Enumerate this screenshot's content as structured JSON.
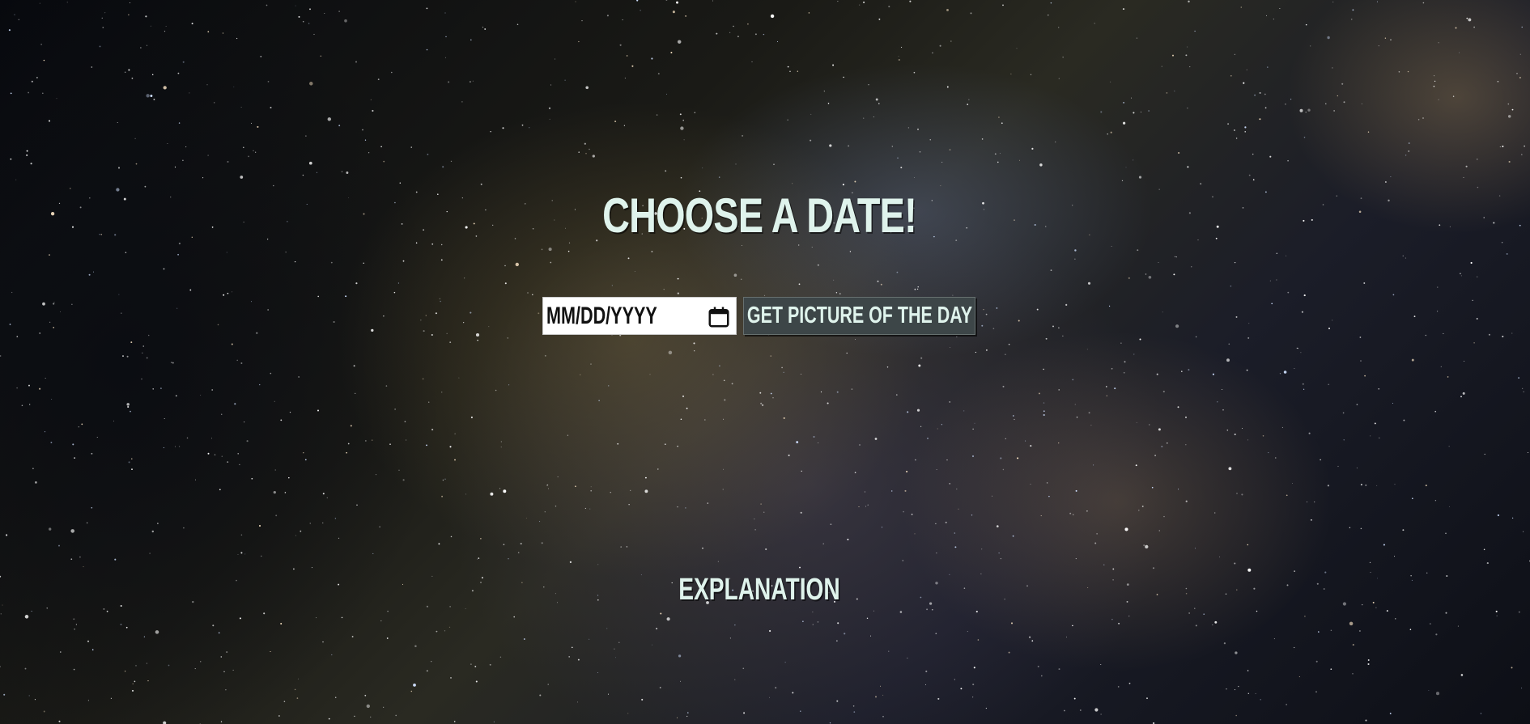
{
  "page": {
    "heading": "Choose a Date!",
    "explanation_heading": "EXPLANATION"
  },
  "date_input": {
    "placeholder": "MM/DD/YYYY",
    "value": "",
    "icon": "calendar-icon"
  },
  "fetch_button": {
    "label": "Get Picture of the Day"
  },
  "colors": {
    "text": "#dff3ec",
    "button_bg": "#3d4648",
    "input_bg": "#ffffff",
    "background": "#0a0c12"
  }
}
